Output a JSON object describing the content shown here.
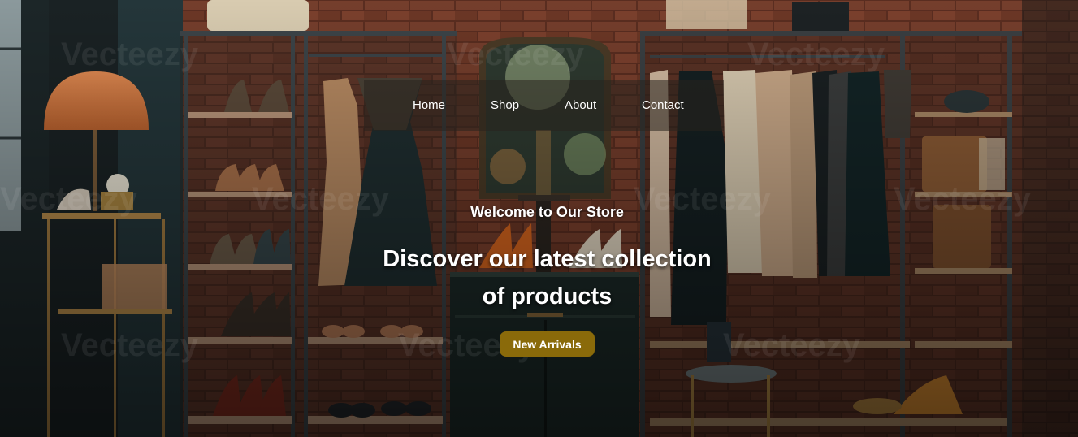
{
  "nav": {
    "items": [
      {
        "label": "Home"
      },
      {
        "label": "Shop"
      },
      {
        "label": "About"
      },
      {
        "label": "Contact"
      }
    ]
  },
  "hero": {
    "welcome": "Welcome to Our Store",
    "headline_line1": "Discover our latest collection",
    "headline_line2": "of products",
    "cta_label": "New Arrivals"
  },
  "watermark": {
    "text": "Vecteezy"
  },
  "colors": {
    "cta_bg": "#8a6a0a",
    "nav_text": "#ffffff",
    "brick": "#8a4a34",
    "shelf_frame": "#3c4448"
  }
}
